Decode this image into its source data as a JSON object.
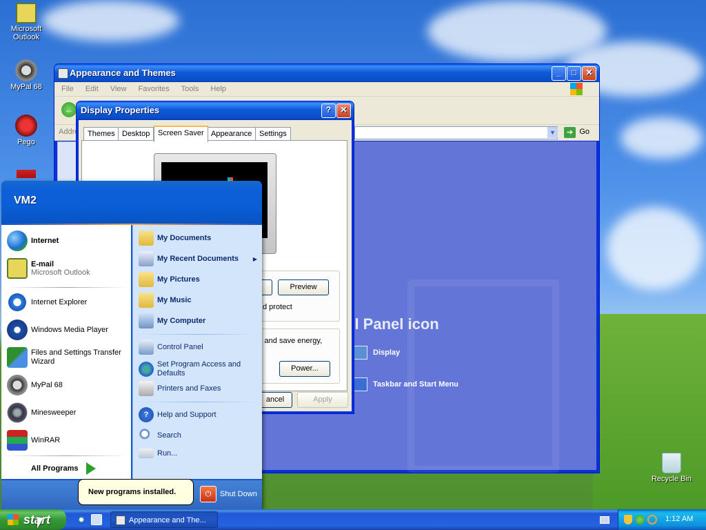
{
  "desktop": {
    "icons": [
      {
        "label": "Microsoft Outlook"
      },
      {
        "label": "MyPal 68"
      },
      {
        "label": "Pego"
      },
      {
        "label": "Recycle Bin"
      }
    ]
  },
  "cp_window": {
    "title": "Appearance and Themes",
    "menu": [
      "File",
      "Edit",
      "View",
      "Favorites",
      "Tools",
      "Help"
    ],
    "address_label": "Addre",
    "go_label": "Go",
    "heading_fragment": "ol Panel icon",
    "links": [
      {
        "label": "Display"
      },
      {
        "label": "Taskbar and Start Menu"
      }
    ],
    "panel_fragment": "l"
  },
  "display_props": {
    "title": "Display Properties",
    "tabs": [
      "Themes",
      "Desktop",
      "Screen Saver",
      "Appearance",
      "Settings"
    ],
    "active_tab": "Screen Saver",
    "preview_button": "Preview",
    "password_fragment": "d protect",
    "energy_fragment": "s and save energy,",
    "power_button": "Power...",
    "cancel_fragment": "ancel",
    "apply_button": "Apply"
  },
  "start_menu": {
    "user": "VM2",
    "pinned": [
      {
        "label": "Internet",
        "sub": ""
      },
      {
        "label": "E-mail",
        "sub": "Microsoft Outlook"
      }
    ],
    "recent": [
      {
        "label": "Internet Explorer"
      },
      {
        "label": "Windows Media Player"
      },
      {
        "label": "Files and Settings Transfer Wizard"
      },
      {
        "label": "MyPal 68"
      },
      {
        "label": "Minesweeper"
      },
      {
        "label": "WinRAR"
      }
    ],
    "all_programs": "All Programs",
    "right_top": [
      {
        "label": "My Documents"
      },
      {
        "label": "My Recent Documents"
      },
      {
        "label": "My Pictures"
      },
      {
        "label": "My Music"
      },
      {
        "label": "My Computer"
      }
    ],
    "right_mid": [
      {
        "label": "Control Panel"
      },
      {
        "label": "Set Program Access and Defaults"
      },
      {
        "label": "Printers and Faxes"
      }
    ],
    "right_bottom": [
      {
        "label": "Help and Support"
      },
      {
        "label": "Search"
      },
      {
        "label": "Run..."
      }
    ],
    "shutdown": "Shut Down",
    "balloon": "New programs installed."
  },
  "taskbar": {
    "start_label": "start",
    "task_button": "Appearance and The...",
    "clock": "1:12 AM"
  },
  "colors": {
    "xp_blue": "#0a5ee6",
    "start_green": "#369836",
    "cp_panel": "#6375d6"
  }
}
